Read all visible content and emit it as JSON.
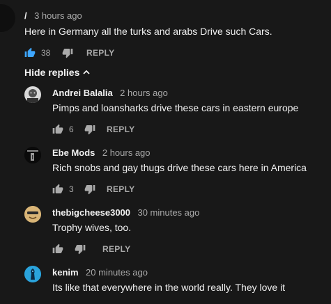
{
  "top_comment": {
    "author": "/",
    "time": "3 hours ago",
    "text": "Here in Germany all the turks and arabs Drive such Cars.",
    "likes": "38",
    "reply_label": "REPLY"
  },
  "hide_replies_label": "Hide replies",
  "replies": [
    {
      "author": "Andrei Balalia",
      "time": "2 hours ago",
      "text": "Pimps and loansharks drive these cars in eastern europe",
      "likes": "6",
      "reply_label": "REPLY"
    },
    {
      "author": "Ebe Mods",
      "time": "2 hours ago",
      "text": "Rich snobs and gay thugs drive these cars here in America",
      "likes": "3",
      "reply_label": "REPLY"
    },
    {
      "author": "thebigcheese3000",
      "time": "30 minutes ago",
      "text": "Trophy wives, too.",
      "likes": "",
      "reply_label": "REPLY"
    },
    {
      "author": "kenim",
      "time": "20 minutes ago",
      "text": "Its like that everywhere in the world really. They love it"
    }
  ],
  "colors": {
    "background": "#181818",
    "text": "#f1f1f1",
    "secondary": "#aaaaaa",
    "liked_blue": "#3ea6ff"
  }
}
